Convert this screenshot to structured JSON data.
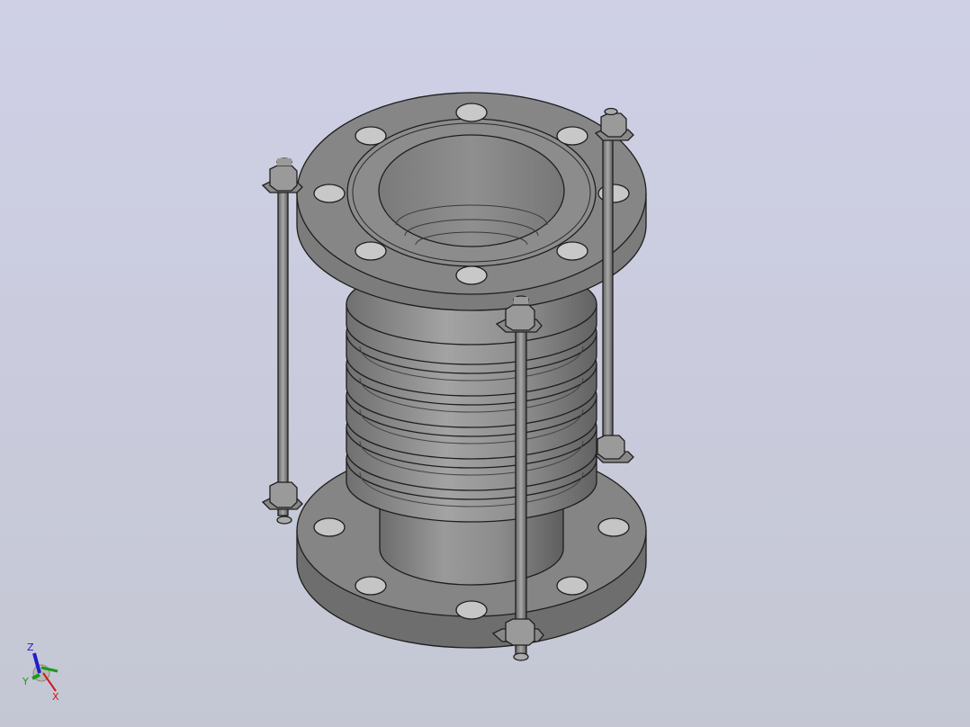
{
  "viewport": {
    "background_top": "#cfd0e6",
    "background_bottom": "#c4c7d3",
    "model_color": "#8a8a8a",
    "edge_color": "#1e1e1e"
  },
  "triad": {
    "z_label": "Z",
    "y_label": "Y",
    "x_label": "X",
    "z_color": "#1f1fc8",
    "y_color": "#1a9a1a",
    "x_color": "#d01818"
  }
}
